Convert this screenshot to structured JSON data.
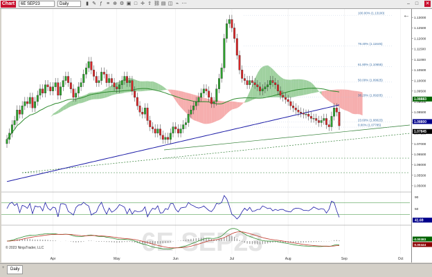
{
  "toolbar": {
    "logo": "Chart",
    "instrument": "6E SEP23",
    "period": "Daily"
  },
  "tabs": {
    "active": "Daily",
    "add": "+"
  },
  "watermark": "6E SEP23",
  "copyright": "© 2023 NinjaTrader, LLC",
  "fib_levels": [
    {
      "label": "100.00% (1.13100)",
      "price": 1.131
    },
    {
      "label": "78.40% (1.11645)",
      "price": 1.11645
    },
    {
      "label": "61.80% (1.10655)",
      "price": 1.10655
    },
    {
      "label": "50.00% (1.09925)",
      "price": 1.09925
    },
    {
      "label": "38.20% (1.09205)",
      "price": 1.09205
    },
    {
      "label": "23.60% (1.08023)",
      "price": 1.08023
    },
    {
      "label": "0.00% (1.07785)",
      "price": 1.07785
    }
  ],
  "price_ticks": [
    "1.13000",
    "1.12500",
    "1.12000",
    "1.11500",
    "1.11000",
    "1.10500",
    "1.10000",
    "1.09500",
    "1.09000",
    "1.08500",
    "1.08000",
    "1.07500",
    "1.07000",
    "1.06500",
    "1.06000",
    "1.05500",
    "1.05000"
  ],
  "price_badges": [
    {
      "text": "1.08883",
      "price": 1.0912,
      "color": "#006400"
    },
    {
      "text": "1.08800",
      "price": 1.0805,
      "color": "#00008b"
    },
    {
      "text": "1.07845",
      "price": 1.0758,
      "color": "#000000"
    }
  ],
  "rsi_ticks": [
    "90",
    "50"
  ],
  "rsi_badge": {
    "text": "41.69",
    "color": "#00008b"
  },
  "macd_badges": [
    {
      "text": "-0.00383",
      "color": "#006400"
    },
    {
      "text": "-0.00444",
      "color": "#8b0000"
    }
  ],
  "months": [
    "Apr",
    "May",
    "Jun",
    "Jul",
    "Aug",
    "Sep",
    "Oct"
  ],
  "chart_data": {
    "type": "candlestick",
    "instrument": "6E SEP23",
    "timeframe": "Daily",
    "ylim": [
      1.048,
      1.134
    ],
    "closes": [
      1.072,
      1.075,
      1.079,
      1.081,
      1.086,
      1.084,
      1.088,
      1.09,
      1.089,
      1.092,
      1.087,
      1.09,
      1.093,
      1.096,
      1.094,
      1.098,
      1.097,
      1.095,
      1.097,
      1.099,
      1.093,
      1.097,
      1.1,
      1.102,
      1.099,
      1.096,
      1.092,
      1.094,
      1.097,
      1.099,
      1.103,
      1.106,
      1.109,
      1.105,
      1.102,
      1.099,
      1.1,
      1.104,
      1.103,
      1.099,
      1.101,
      1.099,
      1.097,
      1.096,
      1.098,
      1.1,
      1.102,
      1.099,
      1.1,
      1.095,
      1.092,
      1.088,
      1.085,
      1.084,
      1.087,
      1.081,
      1.078,
      1.077,
      1.075,
      1.077,
      1.074,
      1.072,
      1.073,
      1.072,
      1.075,
      1.078,
      1.077,
      1.075,
      1.077,
      1.079,
      1.08,
      1.084,
      1.086,
      1.088,
      1.09,
      1.092,
      1.094,
      1.096,
      1.095,
      1.092,
      1.089,
      1.09,
      1.096,
      1.101,
      1.106,
      1.12,
      1.127,
      1.129,
      1.125,
      1.12,
      1.112,
      1.105,
      1.101,
      1.1,
      1.098,
      1.1,
      1.099,
      1.098,
      1.097,
      1.095,
      1.096,
      1.097,
      1.098,
      1.1,
      1.099,
      1.098,
      1.095,
      1.093,
      1.092,
      1.091,
      1.09,
      1.088,
      1.087,
      1.086,
      1.085,
      1.0845,
      1.084,
      1.084,
      1.083,
      1.082,
      1.082,
      1.081,
      1.08,
      1.081,
      1.082,
      1.079,
      1.078,
      1.083,
      1.087,
      1.085,
      1.0785
    ]
  }
}
